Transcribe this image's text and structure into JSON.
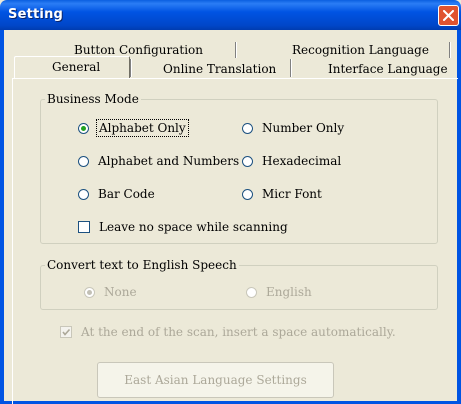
{
  "window": {
    "title": "Setting"
  },
  "tabs": {
    "row1": [
      {
        "label": "Button Configuration"
      },
      {
        "label": "Recognition Language"
      }
    ],
    "row2": [
      {
        "label": "General",
        "active": true
      },
      {
        "label": "Online Translation"
      },
      {
        "label": "Interface Language"
      }
    ]
  },
  "business_mode": {
    "legend": "Business Mode",
    "options": [
      {
        "label": "Alphabet Only",
        "selected": true
      },
      {
        "label": "Number Only",
        "selected": false
      },
      {
        "label": "Alphabet and Numbers",
        "selected": false
      },
      {
        "label": "Hexadecimal",
        "selected": false
      },
      {
        "label": "Bar Code",
        "selected": false
      },
      {
        "label": "Micr Font",
        "selected": false
      }
    ],
    "leave_no_space": {
      "label": "Leave no space while scanning",
      "checked": false
    }
  },
  "speech": {
    "legend": "Convert text to English Speech",
    "options": [
      {
        "label": "None",
        "selected": true,
        "enabled": false
      },
      {
        "label": "English",
        "selected": false,
        "enabled": false
      }
    ]
  },
  "auto_space": {
    "label": "At the end of the scan, insert a space automatically.",
    "checked": true,
    "enabled": false
  },
  "east_asian_button": {
    "label": "East Asian Language Settings",
    "enabled": false
  },
  "colors": {
    "titlebar": "#0054e3",
    "dialog_bg": "#ece9d8",
    "close_button": "#e0532f",
    "disabled_text": "#aca899",
    "radio_dot": "#21a121"
  }
}
